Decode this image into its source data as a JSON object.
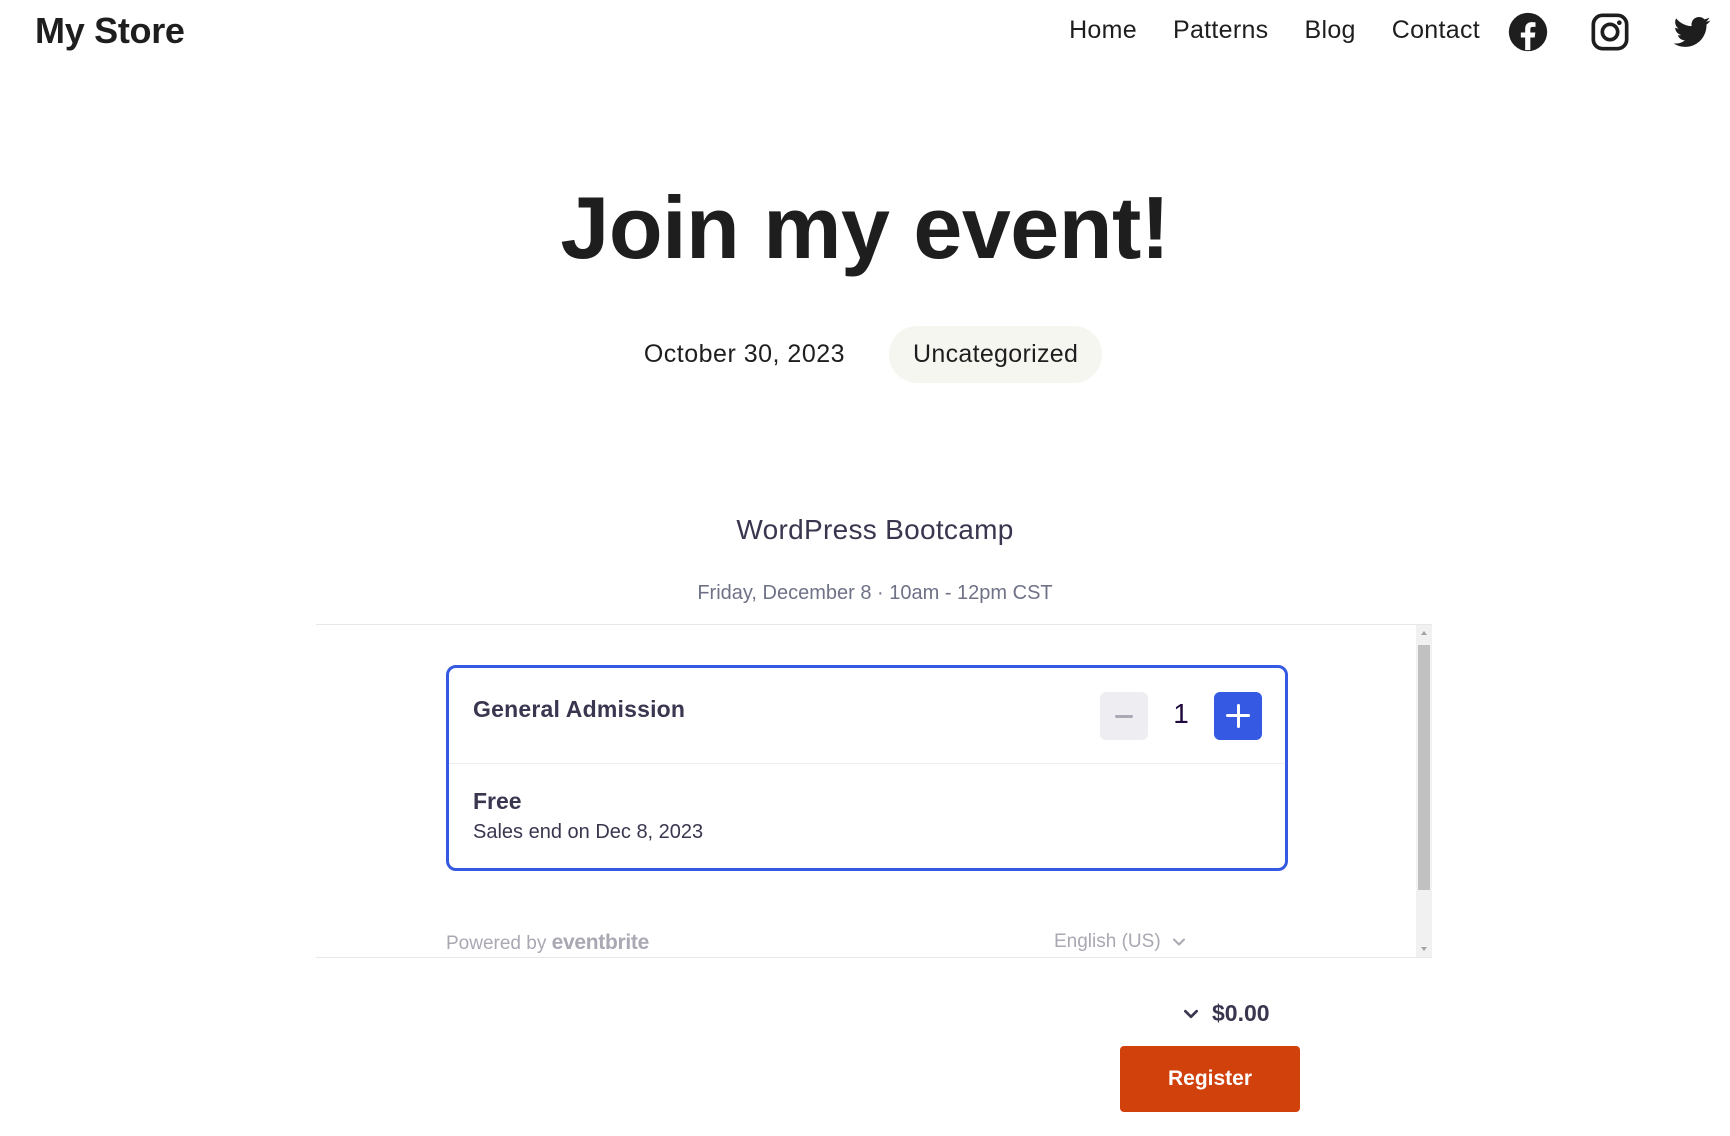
{
  "header": {
    "site_title": "My Store",
    "nav": [
      "Home",
      "Patterns",
      "Blog",
      "Contact"
    ],
    "social_icons": [
      "facebook-icon",
      "instagram-icon",
      "twitter-icon"
    ]
  },
  "post": {
    "title": "Join my event!",
    "date": "October 30, 2023",
    "category": "Uncategorized"
  },
  "event": {
    "name": "WordPress Bootcamp",
    "datetime": "Friday, December 8 · 10am - 12pm CST",
    "ticket": {
      "name": "General Admission",
      "quantity": "1",
      "price": "Free",
      "sales_end": "Sales end on Dec 8, 2023"
    },
    "powered_by_prefix": "Powered by",
    "powered_by_brand": "eventbrite",
    "language": "English (US)",
    "total": "$0.00",
    "register_label": "Register"
  },
  "colors": {
    "accent_blue": "#3659e3",
    "register_orange": "#d1410c",
    "text_dark": "#1e1e1e",
    "category_bg": "#f6f6f1"
  }
}
